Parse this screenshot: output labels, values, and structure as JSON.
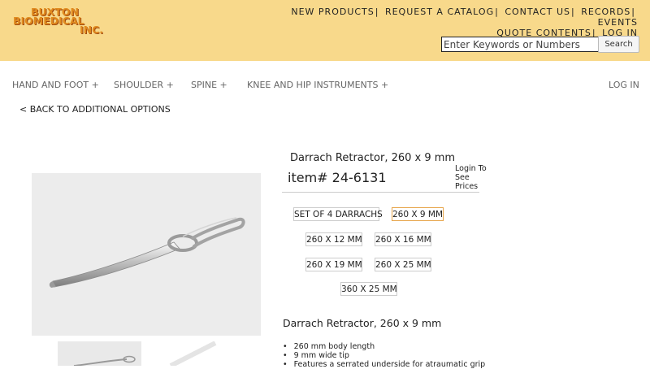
{
  "logo": {
    "line1": "BUXTON",
    "line2": "BIOMEDICAL",
    "line3": "INC."
  },
  "topnav": {
    "row1": [
      "NEW PRODUCTS",
      "REQUEST A CATALOG",
      "CONTACT US",
      "RECORDS",
      "EVENTS"
    ],
    "row2": [
      "QUOTE CONTENTS",
      "LOG IN"
    ],
    "separator": "|"
  },
  "search": {
    "placeholder": "Enter Keywords or Numbers",
    "value": "",
    "button_label": "Search"
  },
  "mainnav": {
    "items": [
      "HAND AND FOOT +",
      "SHOULDER +",
      "SPINE +",
      "KNEE AND HIP INSTRUMENTS +"
    ],
    "login": "LOG IN"
  },
  "back_link": "< BACK TO ADDITIONAL OPTIONS",
  "product": {
    "title": "Darrach Retractor, 260 x 9 mm",
    "item_number": "item# 24-6131",
    "login_prices": "Login To See Prices",
    "options": [
      "SET OF 4 DARRACHS",
      "260 X 9 MM",
      "260 X 12 MM",
      "260 X 16 MM",
      "260 X 19 MM",
      "260 X 25 MM",
      "360 X 25 MM"
    ],
    "selected_option": "260 X 9 MM",
    "description_title": "Darrach Retractor, 260 x 9 mm",
    "features": [
      "260 mm body length",
      "9 mm wide tip",
      "Features a serrated underside for atraumatic grip"
    ]
  },
  "colors": {
    "header_bg": "#f8d98b",
    "logo_orange": "#e08a1e",
    "selected_border": "#e7a54a"
  }
}
